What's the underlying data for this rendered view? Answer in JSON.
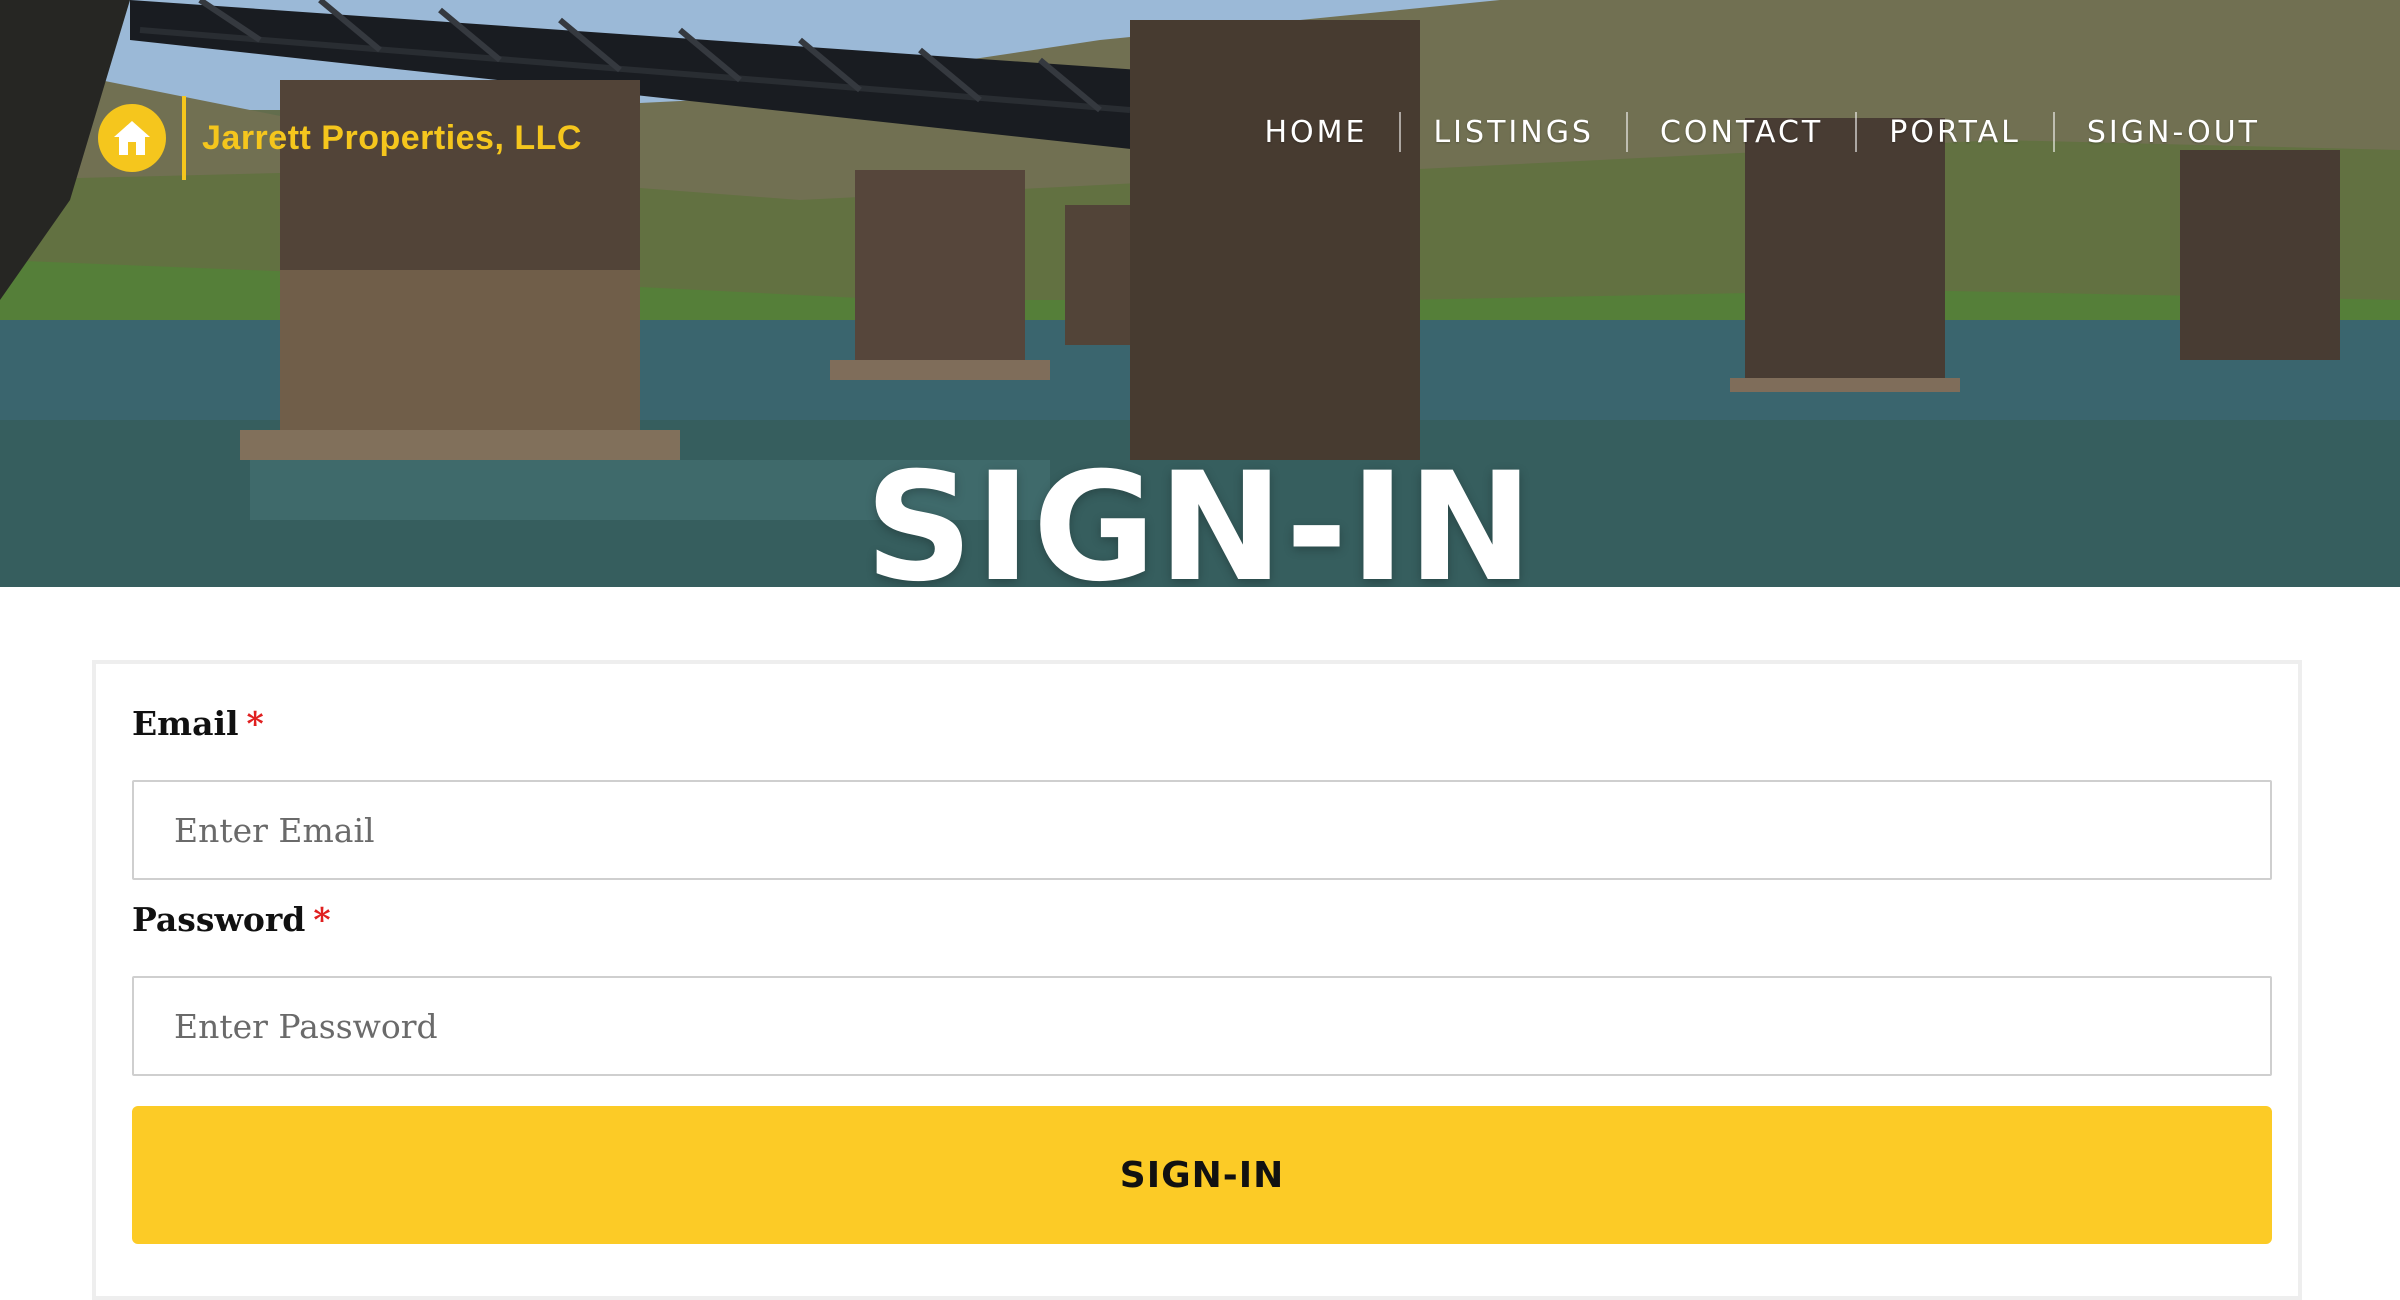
{
  "brand": {
    "name": "Jarrett Properties, LLC",
    "logo_icon": "house-icon",
    "accent_color": "#f5c61d"
  },
  "nav": {
    "items": [
      {
        "label": "HOME"
      },
      {
        "label": "LISTINGS"
      },
      {
        "label": "CONTACT"
      },
      {
        "label": "PORTAL"
      },
      {
        "label": "SIGN-OUT"
      }
    ]
  },
  "hero": {
    "title": "SIGN-IN"
  },
  "form": {
    "email": {
      "label": "Email",
      "required_marker": "*",
      "placeholder": "Enter Email",
      "value": ""
    },
    "password": {
      "label": "Password",
      "required_marker": "*",
      "placeholder": "Enter Password",
      "value": ""
    },
    "submit_label": "SIGN-IN",
    "button_color": "#fccb26"
  }
}
